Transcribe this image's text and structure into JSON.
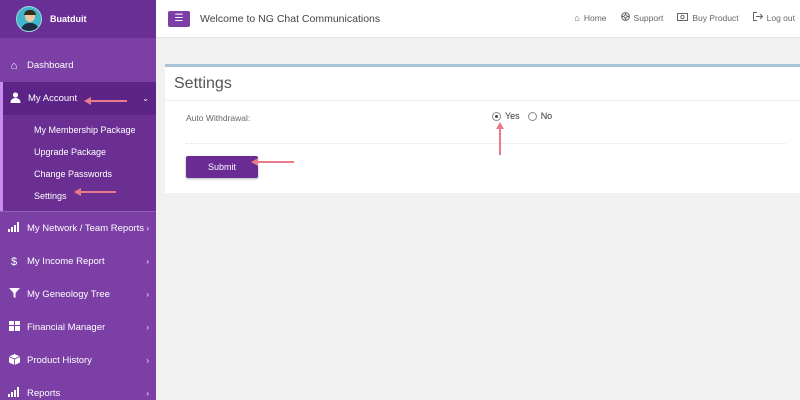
{
  "sidebar": {
    "username": "Buatduit",
    "items": [
      {
        "label": "Dashboard",
        "icon": "home-icon"
      },
      {
        "label": "My Account",
        "icon": "user-icon"
      },
      {
        "label": "My Network / Team Reports",
        "icon": "signal-icon"
      },
      {
        "label": "My Income Report",
        "icon": "dollar-icon"
      },
      {
        "label": "My Geneology Tree",
        "icon": "filter-icon"
      },
      {
        "label": "Financial Manager",
        "icon": "grid-icon"
      },
      {
        "label": "Product History",
        "icon": "box-icon"
      },
      {
        "label": "Reports",
        "icon": "signal-icon"
      }
    ],
    "submenu": [
      {
        "label": "My Membership Package"
      },
      {
        "label": "Upgrade Package"
      },
      {
        "label": "Change Passwords"
      },
      {
        "label": "Settings"
      }
    ]
  },
  "topbar": {
    "title": "Welcome to NG Chat Communications",
    "links": [
      {
        "label": "Home",
        "icon": "home-icon"
      },
      {
        "label": "Support",
        "icon": "lifebuoy-icon"
      },
      {
        "label": "Buy Product",
        "icon": "money-icon"
      },
      {
        "label": "Log out",
        "icon": "logout-icon"
      }
    ]
  },
  "panel": {
    "title": "Settings",
    "field_label": "Auto Withdrawal:",
    "options": [
      {
        "label": "Yes",
        "checked": true
      },
      {
        "label": "No",
        "checked": false
      }
    ],
    "submit_label": "Submit"
  },
  "colors": {
    "sidebar": "#7b3fa5",
    "accent": "#6a2b94",
    "annotation_arrow": "#e87a8a"
  }
}
